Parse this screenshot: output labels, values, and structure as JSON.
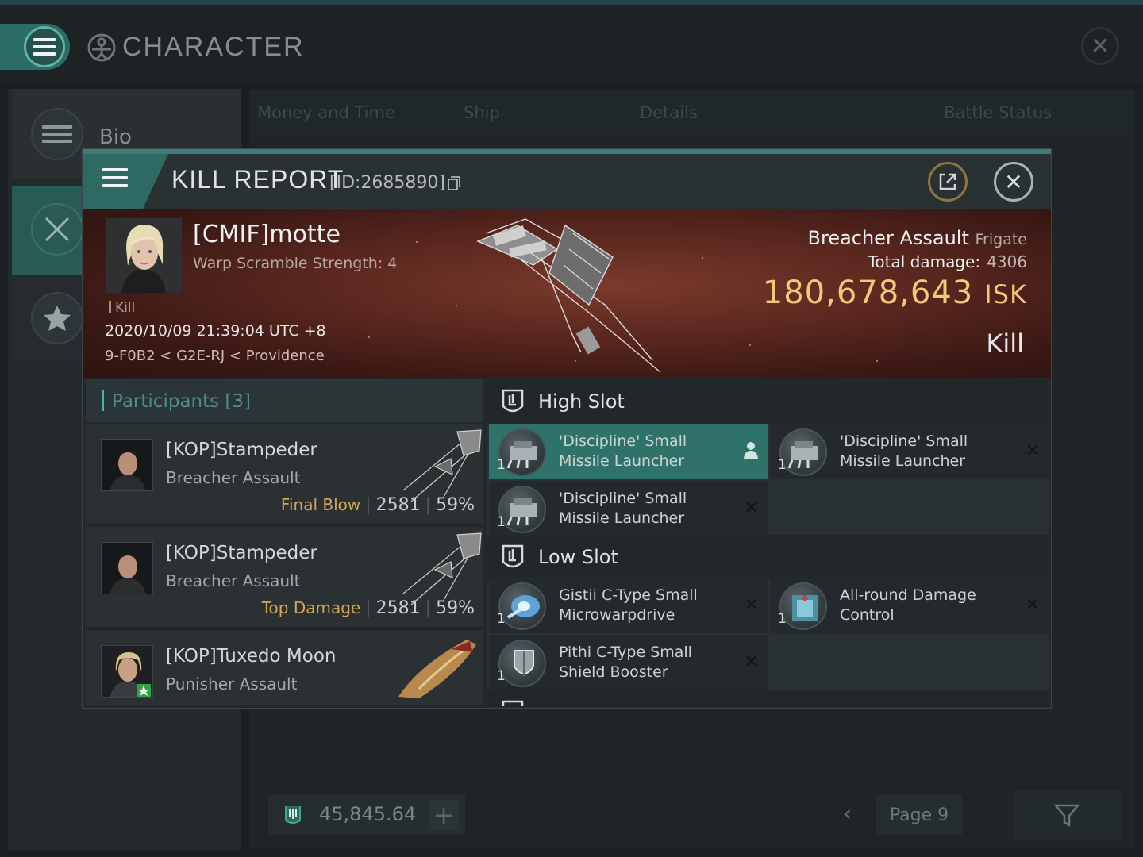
{
  "character_window": {
    "title": "CHARACTER",
    "sidebar": {
      "bio_label": "Bio"
    },
    "tabs": [
      "Money and Time",
      "Ship",
      "Details",
      "Battle Status"
    ],
    "footer": {
      "isk_balance": "45,845.64",
      "page_label": "Page 9"
    }
  },
  "kill_report": {
    "title": "KILL REPORT",
    "report_id": "[ID:2685890]",
    "victim": {
      "name": "[CMIF]motte",
      "subtitle": "Warp Scramble Strength: 4",
      "tag": "Kill",
      "datetime": "2020/10/09 21:39:04 UTC +8",
      "location": "9-F0B2 < G2E-RJ < Providence"
    },
    "ship": {
      "name": "Breacher Assault",
      "class": "Frigate",
      "total_damage_label": "Total damage:",
      "total_damage": "4306",
      "isk_value": "180,678,643",
      "isk_unit": "ISK",
      "result": "Kill"
    },
    "participants": {
      "title": "Participants [3]",
      "list": [
        {
          "name": "[KOP]Stampeder",
          "ship": "Breacher Assault",
          "role": "Final Blow",
          "damage": "2581",
          "percent": "59%"
        },
        {
          "name": "[KOP]Stampeder",
          "ship": "Breacher Assault",
          "role": "Top Damage",
          "damage": "2581",
          "percent": "59%"
        },
        {
          "name": "[KOP]Tuxedo Moon",
          "ship": "Punisher Assault",
          "role": "",
          "damage": "",
          "percent": ""
        }
      ]
    },
    "fitting": {
      "high_slot_label": "High Slot",
      "low_slot_label": "Low Slot",
      "high_slot": [
        {
          "qty": "1",
          "name": "'Discipline' Small Missile Launcher"
        },
        {
          "qty": "1",
          "name": "'Discipline' Small Missile Launcher"
        },
        {
          "qty": "1",
          "name": "'Discipline' Small Missile Launcher"
        }
      ],
      "low_slot": [
        {
          "qty": "1",
          "name": "Gistii C-Type Small Microwarpdrive"
        },
        {
          "qty": "1",
          "name": "All-round Damage Control"
        },
        {
          "qty": "1",
          "name": "Pithi C-Type Small Shield Booster"
        }
      ]
    }
  },
  "colors": {
    "accent_teal": "#2f726a",
    "isk_gold": "#f1c979",
    "final_blow_orange": "#d5a557",
    "banner_red": "#7b3a2b"
  }
}
